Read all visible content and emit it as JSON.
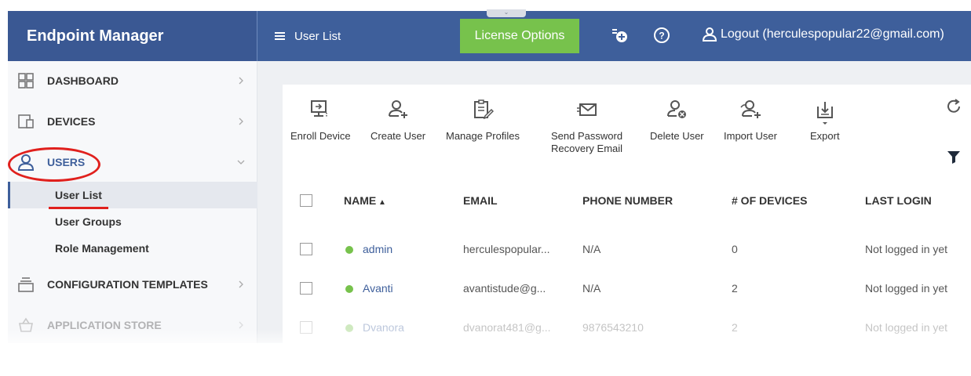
{
  "app": {
    "title": "Endpoint Manager"
  },
  "header": {
    "menu_label": "User List",
    "license_button": "License Options",
    "logout_label": "Logout (herculespopular22@gmail.com)"
  },
  "sidebar": {
    "items": [
      {
        "label": "DASHBOARD",
        "icon": "dashboard-grid-icon"
      },
      {
        "label": "DEVICES",
        "icon": "devices-icon"
      },
      {
        "label": "USERS",
        "icon": "user-icon"
      },
      {
        "label": "CONFIGURATION TEMPLATES",
        "icon": "templates-icon"
      },
      {
        "label": "APPLICATION STORE",
        "icon": "store-basket-icon"
      }
    ],
    "subitems": [
      {
        "label": "User List"
      },
      {
        "label": "User Groups"
      },
      {
        "label": "Role Management"
      }
    ]
  },
  "toolbar": {
    "enroll_device": "Enroll Device",
    "create_user": "Create User",
    "manage_profiles": "Manage Profiles",
    "send_password_line1": "Send Password",
    "send_password_line2": "Recovery Email",
    "delete_user": "Delete User",
    "import_user": "Import User",
    "export": "Export"
  },
  "table": {
    "columns": [
      "NAME",
      "EMAIL",
      "PHONE NUMBER",
      "# OF DEVICES",
      "LAST LOGIN"
    ],
    "rows": [
      {
        "name": "admin",
        "email": "herculespopular...",
        "phone": "N/A",
        "devices": "0",
        "last_login": "Not logged in yet"
      },
      {
        "name": "Avanti",
        "email": "avantistude@g...",
        "phone": "N/A",
        "devices": "2",
        "last_login": "Not logged in yet"
      },
      {
        "name": "Dvanora",
        "email": "dvanorat481@g...",
        "phone": "9876543210",
        "devices": "2",
        "last_login": "Not logged in yet"
      }
    ]
  },
  "colors": {
    "header": "#3e5f9b",
    "accent_green": "#77c24c",
    "highlight_red": "#e0201d"
  }
}
